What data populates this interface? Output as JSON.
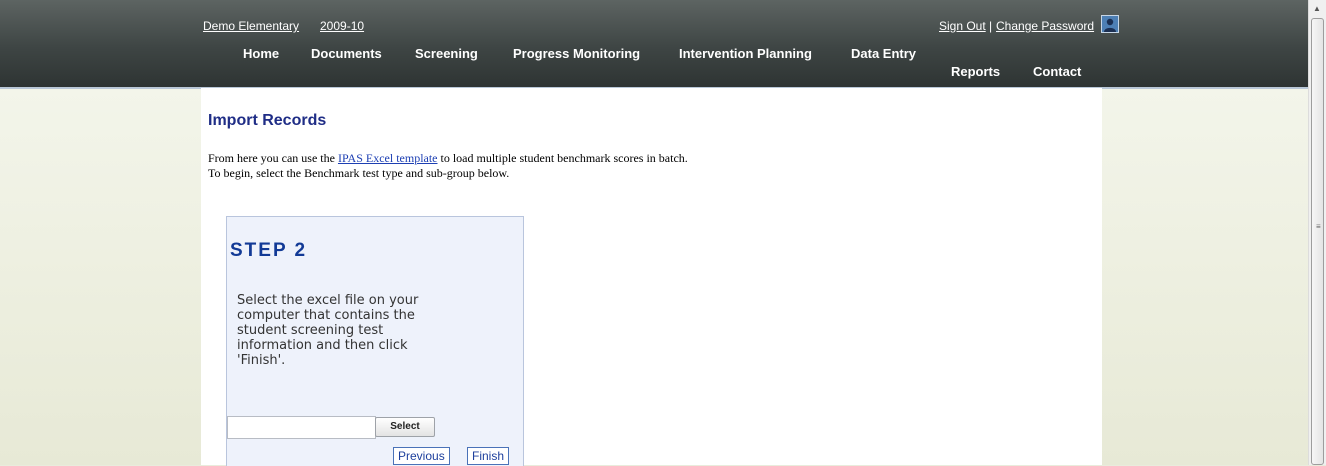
{
  "header": {
    "school": "Demo Elementary",
    "year": "2009-10",
    "sign_out": "Sign Out",
    "separator": "|",
    "change_password": "Change Password",
    "user_icon": "user-icon"
  },
  "nav": {
    "home": "Home",
    "documents": "Documents",
    "screening": "Screening",
    "progress_monitoring": "Progress Monitoring",
    "intervention_planning": "Intervention Planning",
    "data_entry": "Data Entry",
    "reports": "Reports",
    "contact": "Contact"
  },
  "main": {
    "title": "Import Records",
    "intro_before": "From here you can use the ",
    "intro_link": "IPAS Excel template",
    "intro_after": " to load multiple student benchmark scores in batch.",
    "intro_line2": "To begin, select the Benchmark test type and sub-group below."
  },
  "step": {
    "title": "STEP 2",
    "text": "Select the excel file on your computer that contains the student screening test information and then click 'Finish'.",
    "file_value": "",
    "select_label": "Select",
    "previous_label": "Previous",
    "finish_label": "Finish"
  },
  "colors": {
    "header_dark": "#3e4544",
    "title_blue": "#1f2d86",
    "step_blue": "#123a96",
    "link_blue": "#1d3fb3"
  }
}
